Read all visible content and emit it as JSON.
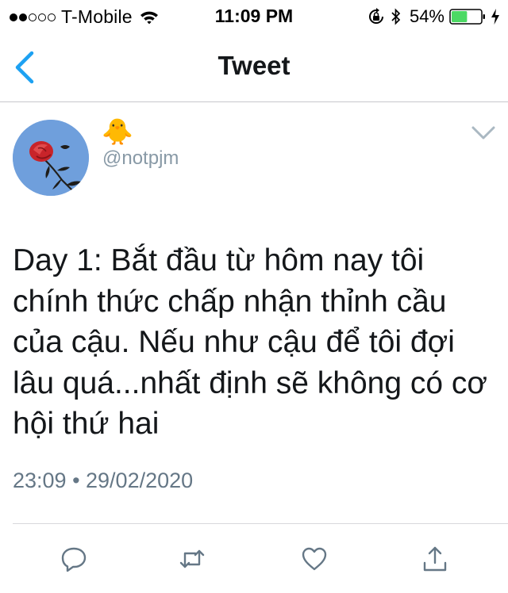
{
  "status_bar": {
    "carrier": "T-Mobile",
    "time": "11:09 PM",
    "battery_percent": "54%",
    "signal_bars": 2,
    "signal_max": 5,
    "battery_level": 0.54,
    "icons": [
      "signal-dots-icon",
      "wifi-icon",
      "rotation-lock-icon",
      "bluetooth-icon",
      "battery-icon",
      "charging-bolt-icon"
    ]
  },
  "nav": {
    "title": "Tweet",
    "back_icon": "chevron-left-icon"
  },
  "tweet": {
    "display_name": "🐥",
    "handle": "@notpjm",
    "avatar_icon": "red-rose-avatar",
    "menu_icon": "chevron-down-icon",
    "text": "Day 1: Bắt đầu từ hôm nay tôi chính thức chấp nhận thỉnh cầu của cậu. Nếu như cậu để tôi đợi lâu quá...nhất định sẽ không có cơ hội thứ hai",
    "timestamp": "23:09 • 29/02/2020"
  },
  "actions": {
    "icons": [
      "reply-icon",
      "retweet-icon",
      "like-icon",
      "share-icon"
    ]
  },
  "colors": {
    "accent": "#1da1f2",
    "battery_fill": "#4cd964",
    "icon_gray": "#657786",
    "handle_gray": "#8899a6",
    "avatar_bg": "#6f9fdc"
  }
}
